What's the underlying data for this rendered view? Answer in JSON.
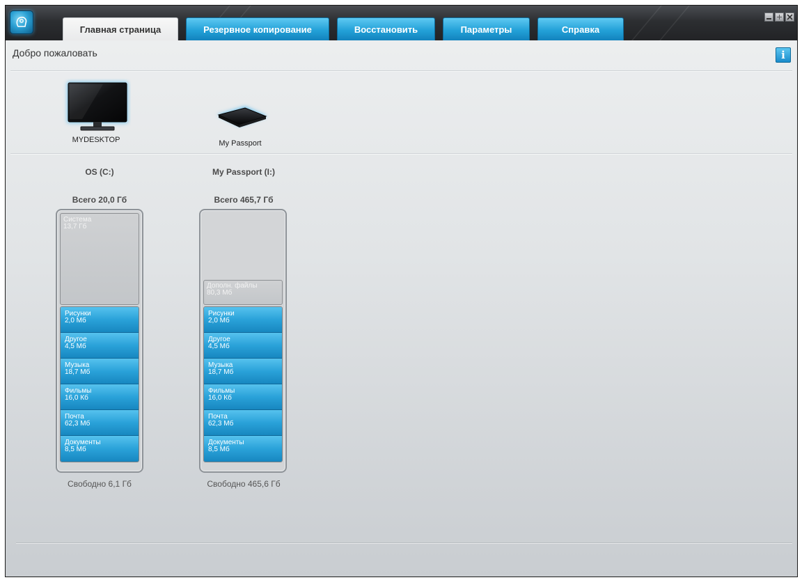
{
  "tabs": [
    {
      "label": "Главная страница",
      "active": true
    },
    {
      "label": "Резервное копирование",
      "active": false
    },
    {
      "label": "Восстановить",
      "active": false
    },
    {
      "label": "Параметры",
      "active": false
    },
    {
      "label": "Справка",
      "active": false
    }
  ],
  "header": {
    "welcome": "Добро пожаловать",
    "info_label": "i"
  },
  "devices": [
    {
      "label": "MYDESKTOP",
      "icon": "monitor-icon"
    },
    {
      "label": "My Passport",
      "icon": "external-drive-icon"
    }
  ],
  "drives": [
    {
      "name": "OS (C:)",
      "total": "Всего 20,0 Гб",
      "top_segment": {
        "label": "Система",
        "value": "13,7 Гб"
      },
      "categories": [
        {
          "label": "Рисунки",
          "value": "2,0 Мб"
        },
        {
          "label": "Другое",
          "value": "4,5 Мб"
        },
        {
          "label": "Музыка",
          "value": "18,7 Мб"
        },
        {
          "label": "Фильмы",
          "value": "16,0 Кб"
        },
        {
          "label": "Почта",
          "value": "62,3 Мб"
        },
        {
          "label": "Документы",
          "value": "8,5 Мб"
        }
      ],
      "free": "Свободно 6,1 Гб"
    },
    {
      "name": "My Passport (I:)",
      "total": "Всего 465,7 Гб",
      "top_segment": {
        "label": "Дополн. файлы",
        "value": "80,3 Мб"
      },
      "categories": [
        {
          "label": "Рисунки",
          "value": "2,0 Мб"
        },
        {
          "label": "Другое",
          "value": "4,5 Мб"
        },
        {
          "label": "Музыка",
          "value": "18,7 Мб"
        },
        {
          "label": "Фильмы",
          "value": "16,0 Кб"
        },
        {
          "label": "Почта",
          "value": "62,3 Мб"
        },
        {
          "label": "Документы",
          "value": "8,5 Мб"
        }
      ],
      "free": "Свободно 465,6 Гб"
    }
  ],
  "colors": {
    "accent_blue": "#2aa2d9",
    "titlebar": "#2c2e31",
    "content_bg": "#e1e4e6"
  }
}
